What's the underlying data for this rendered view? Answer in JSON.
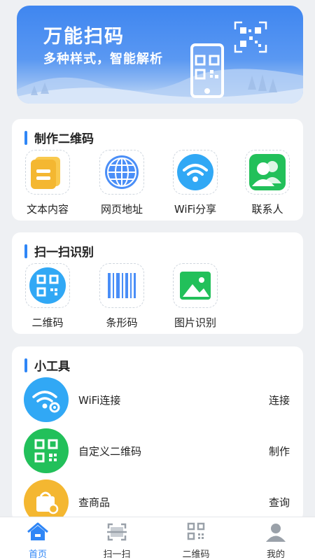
{
  "banner": {
    "title": "万能扫码",
    "subtitle": "多种样式，智能解析"
  },
  "make_section": {
    "title": "制作二维码",
    "items": [
      {
        "label": "文本内容",
        "icon": "text-content-icon"
      },
      {
        "label": "网页地址",
        "icon": "globe-icon"
      },
      {
        "label": "WiFi分享",
        "icon": "wifi-icon"
      },
      {
        "label": "联系人",
        "icon": "contacts-icon"
      }
    ]
  },
  "scan_section": {
    "title": "扫一扫识别",
    "items": [
      {
        "label": "二维码",
        "icon": "qrcode-icon"
      },
      {
        "label": "条形码",
        "icon": "barcode-icon"
      },
      {
        "label": "图片识别",
        "icon": "image-icon"
      }
    ]
  },
  "tools_section": {
    "title": "小工具",
    "items": [
      {
        "name": "WiFi连接",
        "action": "连接",
        "icon": "wifi-gear-icon"
      },
      {
        "name": "自定义二维码",
        "action": "制作",
        "icon": "qrcode-custom-icon"
      },
      {
        "name": "查商品",
        "action": "查询",
        "icon": "shopping-bag-icon"
      }
    ]
  },
  "bottom_nav": {
    "items": [
      {
        "label": "首页",
        "icon": "home-icon",
        "active": true
      },
      {
        "label": "扫一扫",
        "icon": "scan-icon",
        "active": false
      },
      {
        "label": "二维码",
        "icon": "qrcode-nav-icon",
        "active": false
      },
      {
        "label": "我的",
        "icon": "user-icon",
        "active": false
      }
    ]
  },
  "colors": {
    "accent": "#2f86f6",
    "green": "#22c05a",
    "yellow": "#f4b731",
    "sky": "#31a8f5",
    "page_bg": "#eef0f3"
  }
}
